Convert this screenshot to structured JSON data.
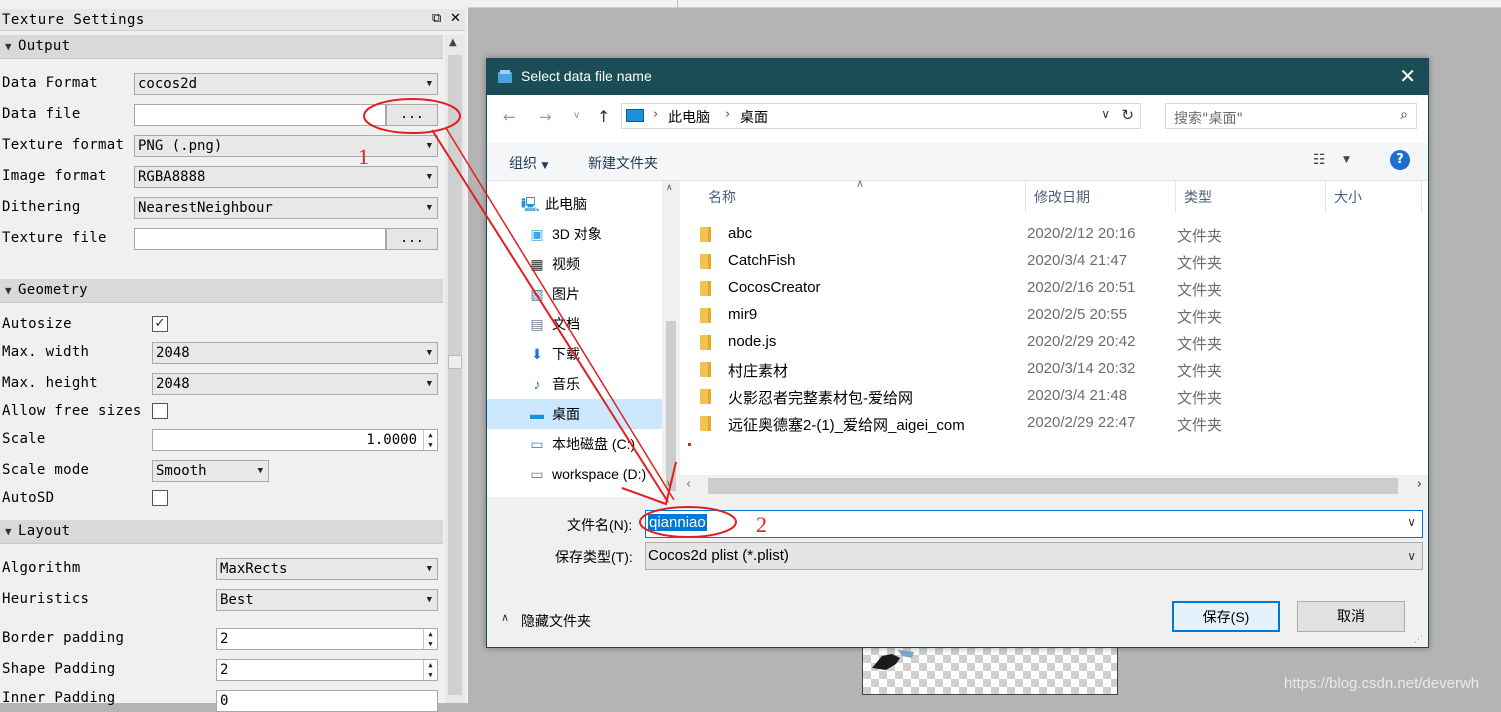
{
  "panel": {
    "title": "Texture Settings",
    "float_icon": "restore-icon",
    "close_icon": "close-icon",
    "sections": {
      "output": "Output",
      "geometry": "Geometry",
      "layout": "Layout"
    },
    "output": {
      "data_format_label": "Data Format",
      "data_format_value": "cocos2d",
      "data_file_label": "Data file",
      "data_file_value": "",
      "browse_label": "...",
      "texture_format_label": "Texture format",
      "texture_format_value": "PNG (.png)",
      "image_format_label": "Image format",
      "image_format_value": "RGBA8888",
      "dithering_label": "Dithering",
      "dithering_value": "NearestNeighbour",
      "texture_file_label": "Texture file",
      "texture_file_value": ""
    },
    "geometry": {
      "autosize_label": "Autosize",
      "autosize_checked": true,
      "max_width_label": "Max. width",
      "max_width_value": "2048",
      "max_height_label": "Max. height",
      "max_height_value": "2048",
      "allow_free_label": "Allow free sizes",
      "allow_free_checked": false,
      "scale_label": "Scale",
      "scale_value": "1.0000",
      "scale_mode_label": "Scale mode",
      "scale_mode_value": "Smooth",
      "autosd_label": "AutoSD",
      "autosd_checked": false
    },
    "layout": {
      "algorithm_label": "Algorithm",
      "algorithm_value": "MaxRects",
      "heuristics_label": "Heuristics",
      "heuristics_value": "Best",
      "border_padding_label": "Border padding",
      "border_padding_value": "2",
      "shape_padding_label": "Shape Padding",
      "shape_padding_value": "2",
      "inner_padding_label": "Inner Padding",
      "inner_padding_value": "0"
    }
  },
  "dialog": {
    "title": "Select data file name",
    "close_icon": "close-icon",
    "breadcrumb": [
      "此电脑",
      "桌面"
    ],
    "search_placeholder": "搜索\"桌面\"",
    "toolbar": {
      "organize": "组织",
      "new_folder": "新建文件夹"
    },
    "nav_items": [
      {
        "label": "此电脑",
        "icon": "computer-icon"
      },
      {
        "label": "3D 对象",
        "icon": "cube-icon"
      },
      {
        "label": "视频",
        "icon": "video-icon"
      },
      {
        "label": "图片",
        "icon": "picture-icon"
      },
      {
        "label": "文档",
        "icon": "document-icon"
      },
      {
        "label": "下载",
        "icon": "download-icon"
      },
      {
        "label": "音乐",
        "icon": "music-icon"
      },
      {
        "label": "桌面",
        "icon": "desktop-icon"
      },
      {
        "label": "本地磁盘 (C:)",
        "icon": "drive-icon"
      },
      {
        "label": "workspace (D:)",
        "icon": "drive-icon"
      }
    ],
    "columns": {
      "name": "名称",
      "date": "修改日期",
      "type": "类型",
      "size": "大小"
    },
    "files": [
      {
        "name": "abc",
        "date": "2020/2/12 20:16",
        "type": "文件夹"
      },
      {
        "name": "CatchFish",
        "date": "2020/3/4 21:47",
        "type": "文件夹"
      },
      {
        "name": "CocosCreator",
        "date": "2020/2/16 20:51",
        "type": "文件夹"
      },
      {
        "name": "mir9",
        "date": "2020/2/5 20:55",
        "type": "文件夹"
      },
      {
        "name": "node.js",
        "date": "2020/2/29 20:42",
        "type": "文件夹"
      },
      {
        "name": "村庄素材",
        "date": "2020/3/14 20:32",
        "type": "文件夹"
      },
      {
        "name": "火影忍者完整素材包-爱给网",
        "date": "2020/3/4 21:48",
        "type": "文件夹"
      },
      {
        "name": "远征奥德塞2-(1)_爱给网_aigei_com",
        "date": "2020/2/29 22:47",
        "type": "文件夹"
      }
    ],
    "filename_label": "文件名(N):",
    "filename_value": "qianniao",
    "filetype_label": "保存类型(T):",
    "filetype_value": "Cocos2d plist (*.plist)",
    "hide_folders": "隐藏文件夹",
    "save": "保存(S)",
    "cancel": "取消"
  },
  "annotations": {
    "step1": "1",
    "step2": "2",
    "color": "#e02020"
  },
  "watermark": "https://blog.csdn.net/deverwh"
}
